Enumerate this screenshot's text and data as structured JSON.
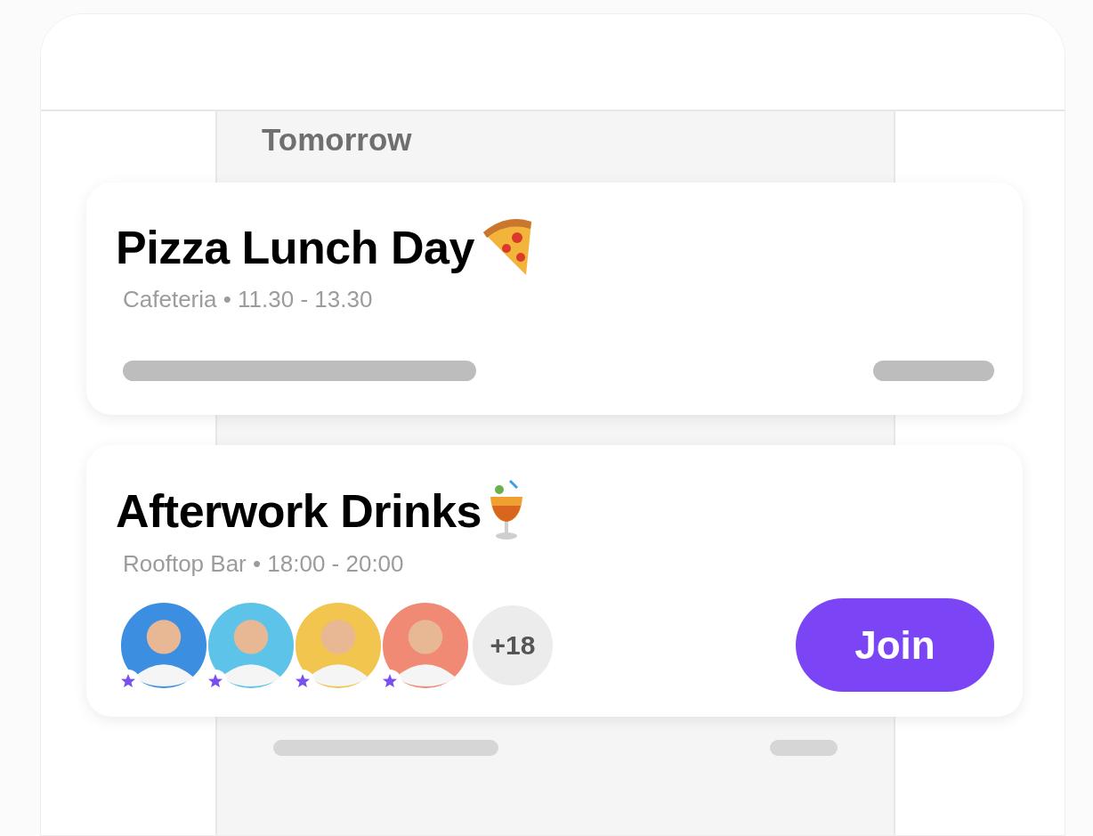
{
  "section_title": "Tomorrow",
  "events": [
    {
      "kind": "placeholder",
      "title": "Pizza Lunch Day",
      "subtitle": "Cafeteria • 11.30 - 13.30"
    },
    {
      "kind": "attendees",
      "title": "Afterwork Drinks",
      "subtitle": "Rooftop Bar • 18:00 - 20:00",
      "avatars": [
        {
          "color": "#3b8ee0",
          "starred": true
        },
        {
          "color": "#5ec3e8",
          "starred": true
        },
        {
          "color": "#f2c54e",
          "starred": true
        },
        {
          "color": "#f08a74",
          "starred": true
        }
      ],
      "more_count": "+18",
      "button": "Join"
    }
  ]
}
